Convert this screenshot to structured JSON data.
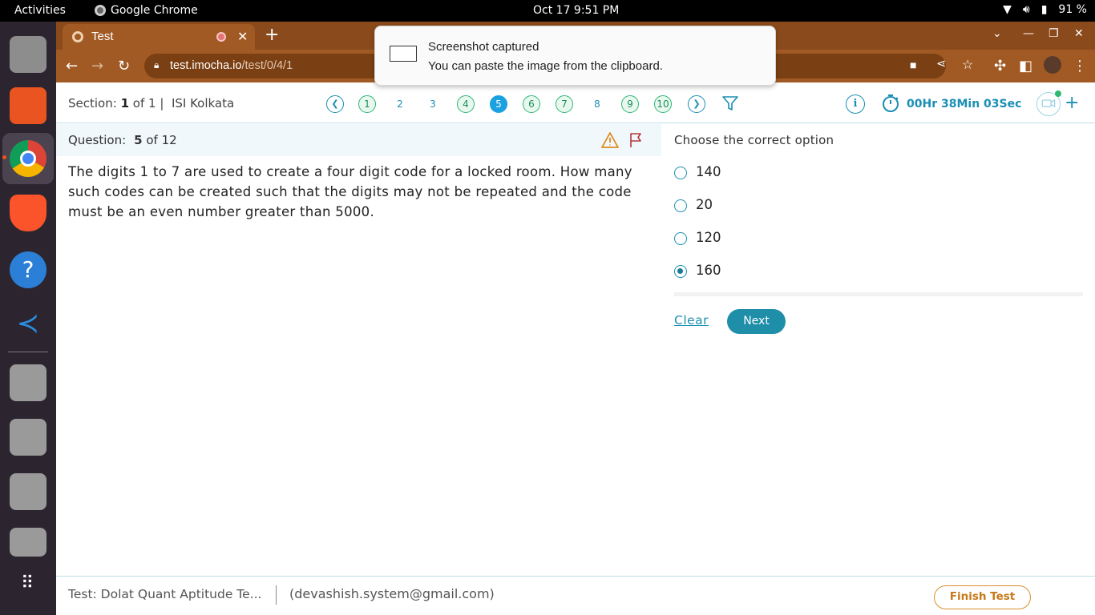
{
  "system": {
    "activities": "Activities",
    "app_name": "Google Chrome",
    "datetime": "Oct 17  9:51 PM",
    "battery": "91 %"
  },
  "browser": {
    "tab_title": "Test",
    "url_host": "test.imocha.io",
    "url_path": "/test/0/4/1"
  },
  "notification": {
    "title": "Screenshot captured",
    "body": "You can paste the image from the clipboard."
  },
  "header": {
    "section_label": "Section:",
    "section_current": "1",
    "section_of": "of 1 |",
    "section_name": "ISI Kolkata",
    "questions": [
      {
        "label": "1",
        "state": "answered"
      },
      {
        "label": "2",
        "state": "plain"
      },
      {
        "label": "3",
        "state": "plain"
      },
      {
        "label": "4",
        "state": "answered"
      },
      {
        "label": "5",
        "state": "current"
      },
      {
        "label": "6",
        "state": "answered"
      },
      {
        "label": "7",
        "state": "answered"
      },
      {
        "label": "8",
        "state": "plain"
      },
      {
        "label": "9",
        "state": "answered"
      },
      {
        "label": "10",
        "state": "answered"
      }
    ],
    "timer": "00Hr 38Min 03Sec"
  },
  "question": {
    "label": "Question:",
    "number": "5",
    "of_total": "of 12",
    "text": "The digits 1 to 7 are used to create a four digit code for a locked room. How many such codes can be created such that the digits may not be repeated and the code must be an even number greater than 5000."
  },
  "options": {
    "prompt": "Choose the correct option",
    "items": [
      {
        "label": "140",
        "selected": false
      },
      {
        "label": "20",
        "selected": false
      },
      {
        "label": "120",
        "selected": false
      },
      {
        "label": "160",
        "selected": true
      }
    ],
    "clear_label": "Clear",
    "next_label": "Next"
  },
  "footer": {
    "test_name": "Test: Dolat Quant Aptitude Te...",
    "email": "(devashish.system@gmail.com)",
    "finish_label": "Finish Test"
  },
  "colors": {
    "accent": "#1a8fb3",
    "current_question": "#1aa1e0",
    "answered": "#2fb872",
    "finish": "#d8902a"
  }
}
